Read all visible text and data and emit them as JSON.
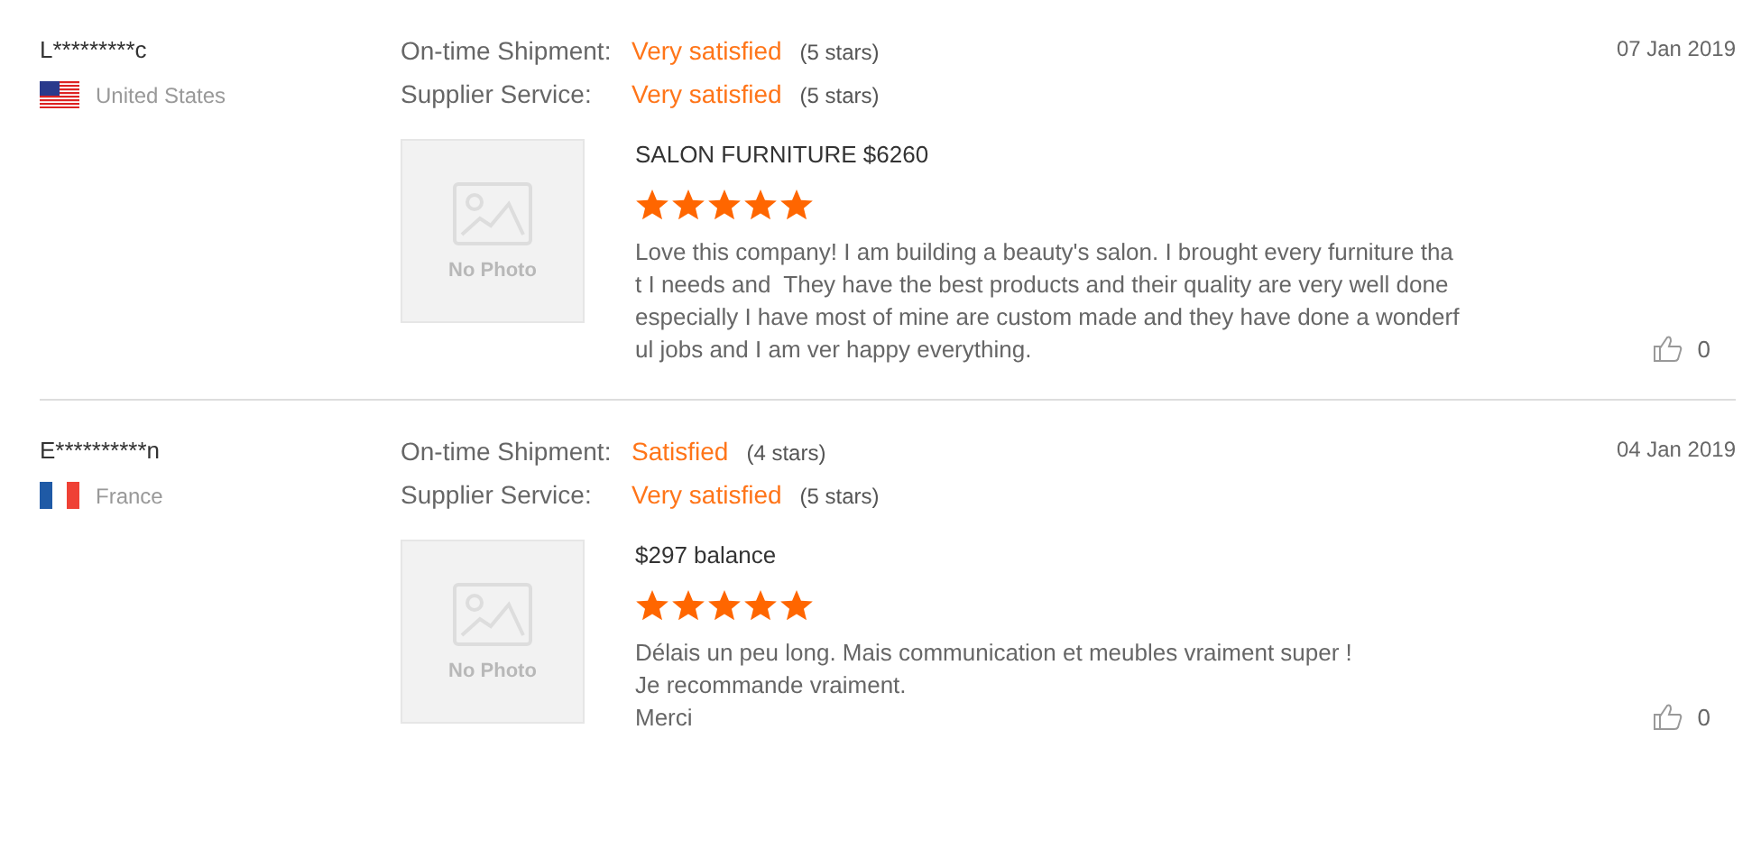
{
  "reviews": [
    {
      "buyer": "L*********c",
      "country": "United States",
      "kind": "us",
      "date": "07 Jan 2019",
      "ratings": [
        {
          "label": "On-time Shipment:",
          "value": "Very satisfied",
          "count": "(5 stars)"
        },
        {
          "label": "Supplier Service:",
          "value": "Very satisfied",
          "count": "(5 stars)"
        }
      ],
      "photo": "No Photo",
      "product": "SALON FURNITURE $6260",
      "stars": 5,
      "text_lines": [
        "Love this company! I am building a beauty's salon. I brought every furniture tha",
        "t I needs and  They have the best products and their quality are very well done",
        "especially I have most of mine are custom made and they have done a wonderf",
        "ul jobs and I am ver happy everything."
      ],
      "likes": "0"
    },
    {
      "buyer": "E**********n",
      "country": "France",
      "kind": "fr",
      "date": "04 Jan 2019",
      "ratings": [
        {
          "label": "On-time Shipment:",
          "value": "Satisfied",
          "count": "(4 stars)"
        },
        {
          "label": "Supplier Service:",
          "value": "Very satisfied",
          "count": "(5 stars)"
        }
      ],
      "photo": "No Photo",
      "product": "$297 balance",
      "stars": 5,
      "text_lines": [
        "Délais un peu long. Mais communication et meubles vraiment super !",
        "Je recommande vraiment.",
        "Merci"
      ],
      "likes": "0"
    }
  ]
}
